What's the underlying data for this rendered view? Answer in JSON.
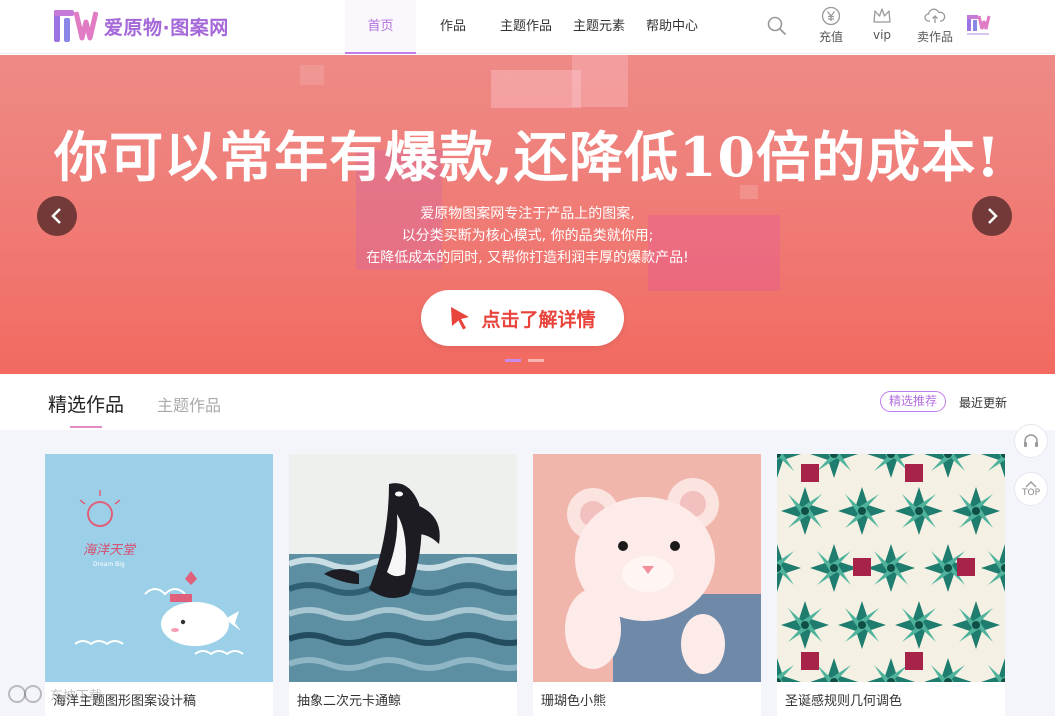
{
  "header": {
    "logo_text": "爱原物·图案网",
    "nav": [
      {
        "label": "首页",
        "active": true
      },
      {
        "label": "作品",
        "active": false
      },
      {
        "label": "主题作品",
        "active": false
      },
      {
        "label": "主题元素",
        "active": false
      },
      {
        "label": "帮助中心",
        "active": false
      }
    ],
    "actions": {
      "recharge": "充值",
      "vip": "vip",
      "sell": "卖作品"
    }
  },
  "banner": {
    "title": "你可以常年有爆款,还降低10倍的成本!",
    "subtitle_lines": [
      "爱原物图案网专注于产品上的图案,",
      "以分类买断为核心模式, 你的品类就你用;",
      "在降低成本的同时, 又帮你打造利润丰厚的爆款产品!"
    ],
    "cta_label": "点击了解详情",
    "slides": 2,
    "active_slide": 1
  },
  "section": {
    "tabs": [
      {
        "label": "精选作品",
        "active": true
      },
      {
        "label": "主题作品",
        "active": false
      }
    ],
    "filter_pill": "精选推荐",
    "filter_latest": "最近更新"
  },
  "cards": [
    {
      "title": "海洋主题图形图案设计稿",
      "image": "sea-whale-cartoon"
    },
    {
      "title": "抽象二次元卡通鲸",
      "image": "orca-ocean-waves"
    },
    {
      "title": "珊瑚色小熊",
      "image": "pink-teddy-bear"
    },
    {
      "title": "圣诞感规则几何调色",
      "image": "geometric-star-pattern"
    }
  ],
  "side": {
    "top_label": "TOP"
  },
  "watermark": "东坡下载"
}
